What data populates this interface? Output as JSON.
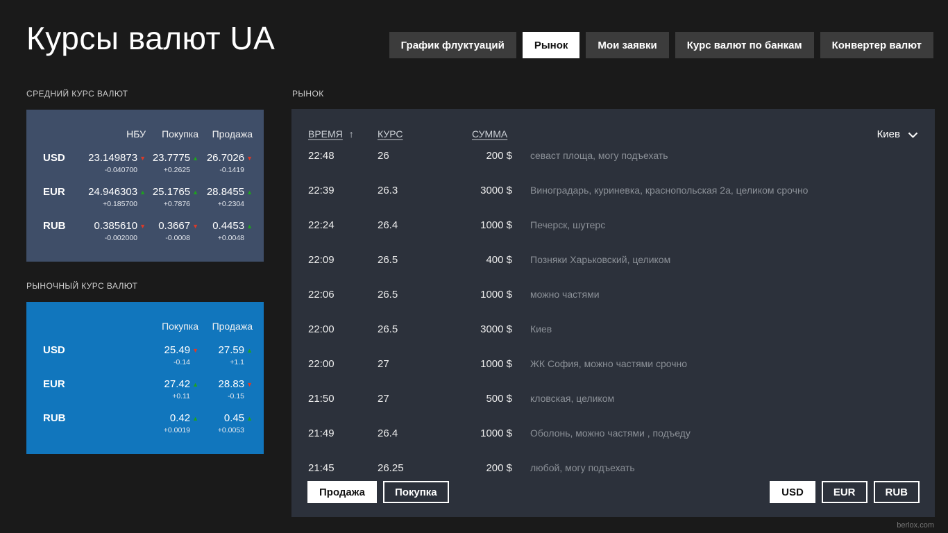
{
  "app": {
    "title": "Курсы валют UA",
    "watermark": "berlox.com"
  },
  "colors": {
    "trend_up": "#1ea31e",
    "trend_down": "#dd3a28",
    "avg_panel_bg": "#3f4e68",
    "market_panel_bg": "#1176bd",
    "market_board_bg": "#2c313b"
  },
  "nav": {
    "tabs": [
      {
        "label": "График флуктуаций",
        "active": false
      },
      {
        "label": "Рынок",
        "active": true
      },
      {
        "label": "Мои заявки",
        "active": false
      },
      {
        "label": "Курс валют по банкам",
        "active": false
      },
      {
        "label": "Конвертер валют",
        "active": false
      }
    ]
  },
  "average_rates": {
    "section_title": "СРЕДНИЙ КУРС ВАЛЮТ",
    "columns": [
      "НБУ",
      "Покупка",
      "Продажа"
    ],
    "rows": [
      {
        "currency": "USD",
        "cells": [
          {
            "value": "23.149873",
            "delta": "-0.040700",
            "trend": "down"
          },
          {
            "value": "23.7775",
            "delta": "+0.2625",
            "trend": "up"
          },
          {
            "value": "26.7026",
            "delta": "-0.1419",
            "trend": "down"
          }
        ]
      },
      {
        "currency": "EUR",
        "cells": [
          {
            "value": "24.946303",
            "delta": "+0.185700",
            "trend": "up"
          },
          {
            "value": "25.1765",
            "delta": "+0.7876",
            "trend": "up"
          },
          {
            "value": "28.8455",
            "delta": "+0.2304",
            "trend": "up"
          }
        ]
      },
      {
        "currency": "RUB",
        "cells": [
          {
            "value": "0.385610",
            "delta": "-0.002000",
            "trend": "down"
          },
          {
            "value": "0.3667",
            "delta": "-0.0008",
            "trend": "down"
          },
          {
            "value": "0.4453",
            "delta": "+0.0048",
            "trend": "up"
          }
        ]
      }
    ]
  },
  "market_rates": {
    "section_title": "РЫНОЧНЫЙ КУРС ВАЛЮТ",
    "columns": [
      "Покупка",
      "Продажа"
    ],
    "rows": [
      {
        "currency": "USD",
        "cells": [
          {
            "value": "25.49",
            "delta": "-0.14",
            "trend": "down"
          },
          {
            "value": "27.59",
            "delta": "+1.1",
            "trend": "up"
          }
        ]
      },
      {
        "currency": "EUR",
        "cells": [
          {
            "value": "27.42",
            "delta": "+0.11",
            "trend": "up"
          },
          {
            "value": "28.83",
            "delta": "-0.15",
            "trend": "down"
          }
        ]
      },
      {
        "currency": "RUB",
        "cells": [
          {
            "value": "0.42",
            "delta": "+0.0019",
            "trend": "up"
          },
          {
            "value": "0.45",
            "delta": "+0.0053",
            "trend": "up"
          }
        ]
      }
    ]
  },
  "market": {
    "section_title": "РЫНОК",
    "header": {
      "time": "ВРЕМЯ",
      "sort_indicator": "↑",
      "rate": "КУРС",
      "amount": "СУММА",
      "city_filter": "Киев"
    },
    "rows": [
      {
        "time": "22:48",
        "rate": "26",
        "amount": "200 $",
        "note": "севаст площа, могу подъехать"
      },
      {
        "time": "22:39",
        "rate": "26.3",
        "amount": "3000 $",
        "note": "Виноградарь, куриневка, краснопольская 2а, целиком срочно"
      },
      {
        "time": "22:24",
        "rate": "26.4",
        "amount": "1000 $",
        "note": "Печерск, шутерс"
      },
      {
        "time": "22:09",
        "rate": "26.5",
        "amount": "400 $",
        "note": "Позняки Харьковский, целиком"
      },
      {
        "time": "22:06",
        "rate": "26.5",
        "amount": "1000 $",
        "note": "можно частями"
      },
      {
        "time": "22:00",
        "rate": "26.5",
        "amount": "3000 $",
        "note": "Киев"
      },
      {
        "time": "22:00",
        "rate": "27",
        "amount": "1000 $",
        "note": "ЖК София, можно частями срочно"
      },
      {
        "time": "21:50",
        "rate": "27",
        "amount": "500 $",
        "note": "кловская, целиком"
      },
      {
        "time": "21:49",
        "rate": "26.4",
        "amount": "1000 $",
        "note": "Оболонь, можно частями , подъеду"
      },
      {
        "time": "21:45",
        "rate": "26.25",
        "amount": "200 $",
        "note": "любой, могу подъехать"
      }
    ],
    "type_filters": [
      {
        "label": "Продажа",
        "active": true
      },
      {
        "label": "Покупка",
        "active": false
      }
    ],
    "currency_filters": [
      {
        "label": "USD",
        "active": true
      },
      {
        "label": "EUR",
        "active": false
      },
      {
        "label": "RUB",
        "active": false
      }
    ]
  }
}
